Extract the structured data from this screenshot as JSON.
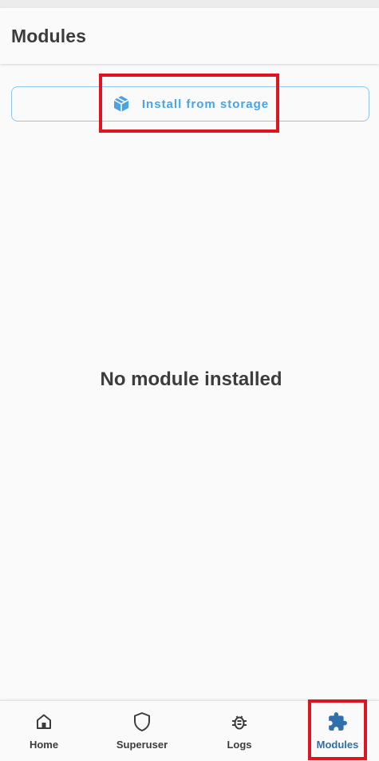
{
  "appbar": {
    "title": "Modules"
  },
  "actions": {
    "install_label": "Install from storage",
    "install_icon": "package-icon"
  },
  "main": {
    "empty_text": "No module installed"
  },
  "bottom_nav": {
    "items": [
      {
        "label": "Home",
        "icon": "home-icon",
        "active": false
      },
      {
        "label": "Superuser",
        "icon": "shield-icon",
        "active": false
      },
      {
        "label": "Logs",
        "icon": "bug-icon",
        "active": false
      },
      {
        "label": "Modules",
        "icon": "puzzle-icon",
        "active": true
      }
    ]
  },
  "colors": {
    "accent": "#4aa3e6",
    "active_nav": "#2f6fab",
    "highlight": "#e0141e",
    "text": "#3c3c3c"
  }
}
